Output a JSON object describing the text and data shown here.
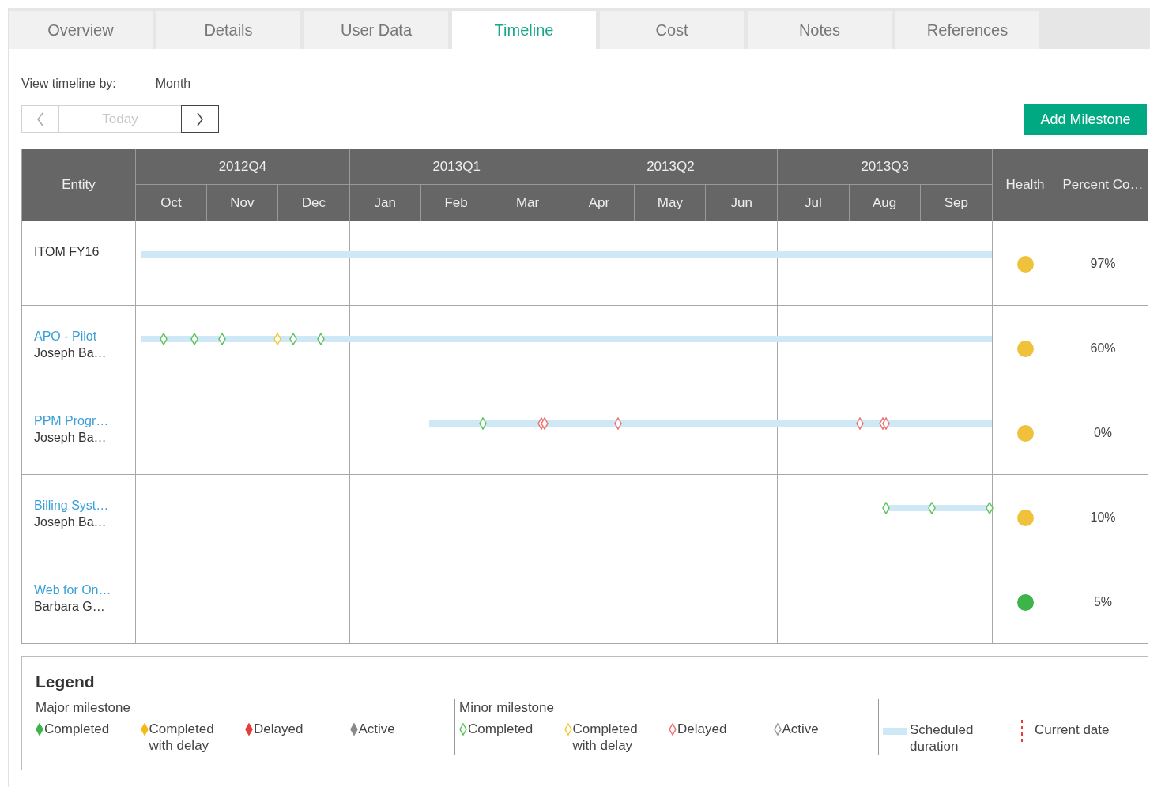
{
  "tabs": [
    {
      "label": "Overview",
      "selected": false
    },
    {
      "label": "Details",
      "selected": false
    },
    {
      "label": "User Data",
      "selected": false
    },
    {
      "label": "Timeline",
      "selected": true
    },
    {
      "label": "Cost",
      "selected": false
    },
    {
      "label": "Notes",
      "selected": false
    },
    {
      "label": "References",
      "selected": false
    }
  ],
  "view_by": {
    "label": "View timeline by:",
    "value": "Month"
  },
  "nav": {
    "today": "Today"
  },
  "add_button": "Add Milestone",
  "table": {
    "entity_header": "Entity",
    "health_header": "Health",
    "percent_header": "Percent Co…",
    "quarters": [
      {
        "label": "2012Q4",
        "months": [
          "Oct",
          "Nov",
          "Dec"
        ]
      },
      {
        "label": "2013Q1",
        "months": [
          "Jan",
          "Feb",
          "Mar"
        ]
      },
      {
        "label": "2013Q2",
        "months": [
          "Apr",
          "May",
          "Jun"
        ]
      },
      {
        "label": "2013Q3",
        "months": [
          "Jul",
          "Aug",
          "Sep"
        ]
      }
    ],
    "rows": [
      {
        "name": "ITOM FY16",
        "link": false,
        "bar": {
          "level": 0.994
        },
        "milestones": [],
        "health": {
          "color": "#f0c23b"
        },
        "percent": "97%"
      },
      {
        "name": "APO - Pilot",
        "owner": "Joseph Ba…",
        "link": true,
        "bar": {
          "level": 0.994
        },
        "milestones": [
          {
            "kind": "completed",
            "level": 0.032
          },
          {
            "kind": "completed",
            "level": 0.068
          },
          {
            "kind": "completed",
            "level": 0.101
          },
          {
            "kind": "completed_with_delay",
            "level": 0.165
          },
          {
            "kind": "completed",
            "level": 0.184
          },
          {
            "kind": "completed",
            "level": 0.216
          }
        ],
        "health": {
          "color": "#f0c23b"
        },
        "percent": "60%"
      },
      {
        "name": "PPM Progr…",
        "owner": "Joseph Ba…",
        "link": true,
        "bar": {
          "level": 0.657
        },
        "milestones": [
          {
            "kind": "completed",
            "level": 0.405
          },
          {
            "kind": "delayed",
            "level": 0.474
          },
          {
            "kind": "delayed",
            "level": 0.477
          },
          {
            "kind": "delayed",
            "level": 0.563
          },
          {
            "kind": "delayed",
            "level": 0.846
          },
          {
            "kind": "delayed",
            "level": 0.873
          },
          {
            "kind": "delayed",
            "level": 0.876
          }
        ],
        "health": {
          "color": "#f0c23b"
        },
        "percent": "0%"
      },
      {
        "name": "Billing Syst…",
        "owner": "Joseph Ba…",
        "link": true,
        "bar": {
          "level": 0.124
        },
        "milestones": [
          {
            "kind": "completed",
            "level": 0.876
          },
          {
            "kind": "completed",
            "level": 0.93
          },
          {
            "kind": "completed",
            "level": 0.997
          }
        ],
        "health": {
          "color": "#f0c23b"
        },
        "percent": "10%"
      },
      {
        "name": "Web for On…",
        "owner": "Barbara G…",
        "link": true,
        "milestones": [],
        "health": {
          "color": "#3cb449"
        },
        "percent": "5%"
      }
    ]
  },
  "legend": {
    "title": "Legend",
    "groups": [
      {
        "title": "Major milestone",
        "kind": "major",
        "items": [
          {
            "kind": "completed",
            "label": "Completed"
          },
          {
            "kind": "completed_with_delay",
            "label": "Completed with delay"
          },
          {
            "kind": "delayed",
            "label": "Delayed"
          },
          {
            "kind": "active",
            "label": "Active"
          }
        ]
      },
      {
        "title": "Minor milestone",
        "kind": "minor",
        "items": [
          {
            "kind": "completed",
            "label": "Completed"
          },
          {
            "kind": "completed_with_delay",
            "label": "Completed with delay"
          },
          {
            "kind": "delayed",
            "label": "Delayed"
          },
          {
            "kind": "active",
            "label": "Active"
          }
        ]
      }
    ],
    "extras": [
      {
        "kind": "duration",
        "label": "Scheduled duration"
      },
      {
        "kind": "current_date",
        "label": "Current date"
      }
    ]
  }
}
